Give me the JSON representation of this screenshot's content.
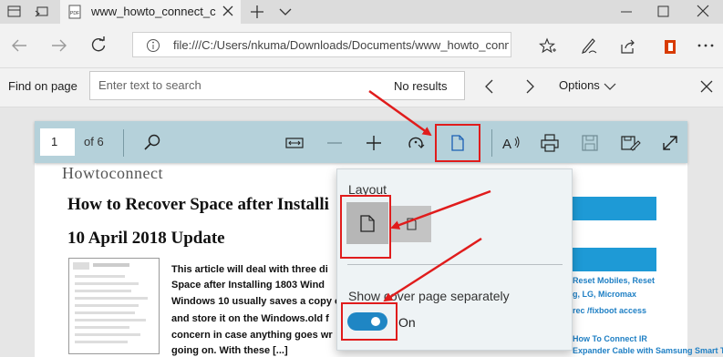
{
  "browser": {
    "tab_title": "www_howto_connect_c",
    "address": "file:///C:/Users/nkuma/Downloads/Documents/www_howto_conn"
  },
  "find_bar": {
    "label": "Find on page",
    "placeholder": "Enter text to search",
    "results": "No results",
    "options_label": "Options"
  },
  "pdf_toolbar": {
    "page_number": "1",
    "page_count": "of 6"
  },
  "layout_flyout": {
    "title": "Layout",
    "cover_label": "Show cover page separately",
    "toggle_state": "On",
    "toggle_on": true
  },
  "document": {
    "site_name": "Howtoconnect",
    "title_line1": "How to Recover Space after Installi",
    "title_line2": "10 April 2018 Update",
    "paragraph": [
      "This article will deal with three di",
      "Space after Installing 1803 Wind",
      "Windows 10 usually saves a copy o",
      "and store it on the Windows.old f",
      "concern in case anything goes wr",
      "going on. With these [...]"
    ],
    "sidebar_links": [
      "Reset Mobiles, Reset",
      "g, LG, Micromax",
      "rec /fixboot access",
      "How To Connect IR",
      "Expander Cable with Samsung Smart TV"
    ]
  },
  "colors": {
    "toolbar": "#b5d1da",
    "annotation": "#e01c1c",
    "toggle": "#1f86c4",
    "sidebar_accent": "#1e9ad6"
  }
}
